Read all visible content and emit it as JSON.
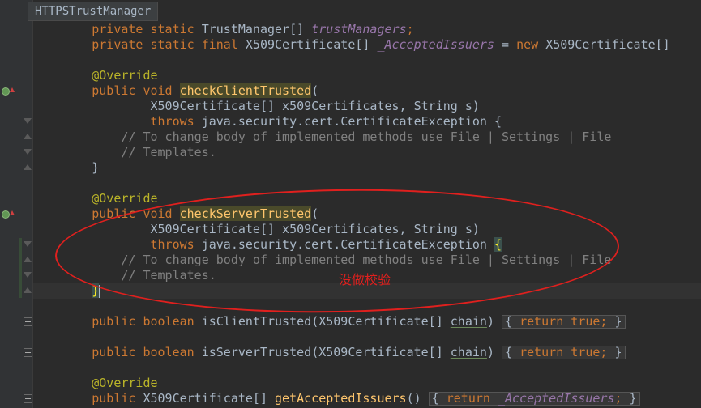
{
  "breadcrumb": "HTTPSTrustManager",
  "lines": {
    "l1": {
      "kw": "private static ",
      "type": "TrustManager[] ",
      "field": "trustManagers",
      "end": ";"
    },
    "l2": {
      "kw": "private static final ",
      "type": "X509Certificate[] ",
      "field": "_AcceptedIssuers",
      "mid": " = ",
      "kw2": "new ",
      "tail": "X509Certificate[]"
    },
    "l3": {
      "ann": "@Override"
    },
    "l4": {
      "kw": "public void ",
      "meth": "checkClientTrusted",
      "tail": "("
    },
    "l5": {
      "text": "        X509Certificate[] x509Certificates, String s)"
    },
    "l6": {
      "kw": "        throws ",
      "tail": "java.security.cert.CertificateException {"
    },
    "l7": {
      "cmt": "    // To change body of implemented methods use File | Settings | File"
    },
    "l8": {
      "cmt": "    // Templates."
    },
    "l9": {
      "text": "}"
    },
    "l10": {
      "ann": "@Override"
    },
    "l11": {
      "kw": "public void ",
      "meth": "checkServerTrusted",
      "tail": "("
    },
    "l12": {
      "text": "        X509Certificate[] x509Certificates, String s)"
    },
    "l13": {
      "kw": "        throws ",
      "tail": "java.security.cert.CertificateException ",
      "brace": "{"
    },
    "l14": {
      "cmt": "    // To change body of implemented methods use File | Settings | File"
    },
    "l15": {
      "cmt": "    // Templates."
    },
    "l16": {
      "brace": "}"
    },
    "l17": {
      "kw": "public boolean ",
      "meth": "isClientTrusted",
      "mid": "(X509Certificate[] ",
      "param": "chain",
      "close": ")",
      "fold": "{ ",
      "kwr": "return true;",
      "foldend": " }"
    },
    "l18": {
      "kw": "public boolean ",
      "meth": "isServerTrusted",
      "mid": "(X509Certificate[] ",
      "param": "chain",
      "close": ")",
      "fold": "{ ",
      "kwr": "return true;",
      "foldend": " }"
    },
    "l19": {
      "ann": "@Override"
    },
    "l20": {
      "kw": "public ",
      "type": "X509Certificate[] ",
      "meth": "getAcceptedIssuers",
      "mid": "() ",
      "fold": "{ ",
      "kwr": "return ",
      "field": "_AcceptedIssuers",
      "semi": ";",
      "foldend": " }"
    }
  },
  "annotation": {
    "text": "没做校验",
    "color": "#e0201e"
  },
  "colors": {
    "keyword": "#cc7832",
    "annotation": "#bbb529",
    "field": "#9876aa",
    "comment": "#808080",
    "method": "#ffc66d",
    "background": "#2b2b2b"
  }
}
